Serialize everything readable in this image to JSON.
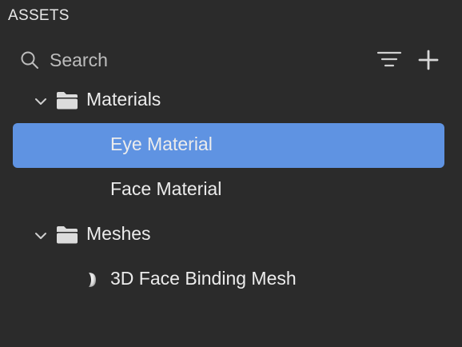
{
  "panel": {
    "title": "ASSETS"
  },
  "search": {
    "placeholder": "Search",
    "value": ""
  },
  "icons": {
    "search": "search-icon",
    "filter": "filter-icon",
    "add": "plus-icon",
    "chevron": "chevron-down-icon",
    "folder": "folder-icon",
    "mesh": "face-mesh-icon"
  },
  "colors": {
    "background": "#2b2b2b",
    "selection": "#5f93e2",
    "text": "#ececec",
    "icon": "#bdbdbd"
  },
  "tree": {
    "materials_folder": {
      "label": "Materials",
      "expanded": true,
      "items": [
        {
          "label": "Eye Material",
          "selected": true
        },
        {
          "label": "Face Material",
          "selected": false
        }
      ]
    },
    "meshes_folder": {
      "label": "Meshes",
      "expanded": true,
      "items": [
        {
          "label": "3D Face Binding Mesh",
          "selected": false
        }
      ]
    }
  }
}
